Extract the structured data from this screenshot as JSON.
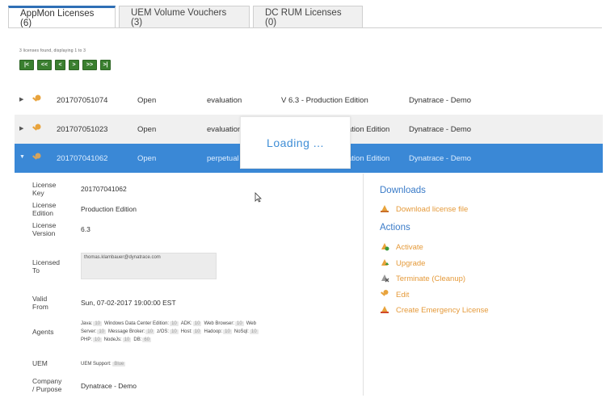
{
  "tabs": [
    {
      "label": "AppMon Licenses (6)",
      "active": true
    },
    {
      "label": "UEM Volume Vouchers (3)",
      "active": false
    },
    {
      "label": "DC RUM Licenses (0)",
      "active": false
    }
  ],
  "pager": {
    "info": "3 licenses found, displaying 1 to 3",
    "buttons": [
      "|<",
      "<<",
      "<",
      ">",
      ">>",
      ">|"
    ]
  },
  "rows": [
    {
      "id": "201707051074",
      "status": "Open",
      "type": "evaluation",
      "version": "V 6.3 - Production Edition",
      "customer": "Dynatrace - Demo"
    },
    {
      "id": "201707051023",
      "status": "Open",
      "type": "evaluation",
      "version": "ation Edition",
      "customer": "Dynatrace - Demo"
    },
    {
      "id": "201707041062",
      "status": "Open",
      "type": "perpetual",
      "version": "ation Edition",
      "customer": "Dynatrace - Demo"
    }
  ],
  "loading": "Loading ...",
  "details": {
    "license_key_label": [
      "License",
      "Key"
    ],
    "license_key": "201707041062",
    "edition_label": [
      "License",
      "Edition"
    ],
    "edition": "Production Edition",
    "version_label": [
      "License",
      "Version"
    ],
    "version": "6.3",
    "licensed_to_label": [
      "Licensed",
      "To"
    ],
    "licensed_to": "thomas.klambauer@dynatrace.com",
    "valid_from_label": [
      "Valid",
      "From"
    ],
    "valid_from": "Sun, 07-02-2017 19:00:00 EST",
    "agents_label": "Agents",
    "agents": [
      {
        "name": "Java:",
        "val": "10"
      },
      {
        "name": "Windows Data Center Edition:",
        "val": "10"
      },
      {
        "name": "ADK:",
        "val": "10"
      },
      {
        "name": "Web Browser:",
        "val": "10"
      },
      {
        "name": "Web",
        "val": ""
      },
      {
        "name": "Server:",
        "val": "10"
      },
      {
        "name": "Message Broker:",
        "val": "10"
      },
      {
        "name": "z/OS:",
        "val": "10"
      },
      {
        "name": "Host:",
        "val": "10"
      },
      {
        "name": "Hadoop:",
        "val": "10"
      },
      {
        "name": "NoSql:",
        "val": "10"
      },
      {
        "name": "PHP:",
        "val": "10"
      },
      {
        "name": "NodeJs:",
        "val": "10"
      },
      {
        "name": "DB:",
        "val": "60"
      }
    ],
    "uem_label": "UEM",
    "uem_support_label": "UEM Support:",
    "uem_support_value": "Blue",
    "company_label": [
      "Company",
      "/ Purpose"
    ],
    "company": "Dynatrace - Demo"
  },
  "downloads": {
    "title": "Downloads",
    "link": "Download license file"
  },
  "actions": {
    "title": "Actions",
    "items": [
      "Activate",
      "Upgrade",
      "Terminate (Cleanup)",
      "Edit",
      "Create Emergency License"
    ]
  },
  "colors": {
    "accent": "#2f6fb5",
    "selected_row": "#3a88d6",
    "pager_green": "#3a7f2f",
    "action_orange": "#e59a3a",
    "header_blue": "#3a7bc8"
  }
}
